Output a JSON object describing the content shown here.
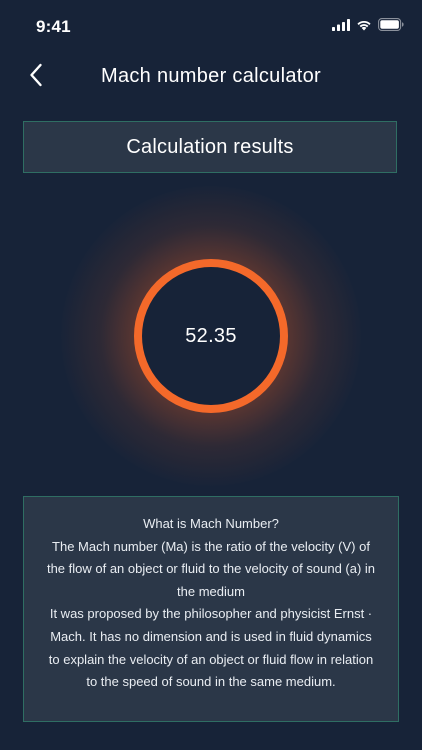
{
  "status": {
    "time": "9:41",
    "icons": [
      "cellular-signal-icon",
      "wifi-icon",
      "battery-icon"
    ]
  },
  "nav": {
    "title": "Mach number calculator",
    "back_icon": "chevron-left-icon"
  },
  "results": {
    "header": "Calculation results",
    "value": "52.35"
  },
  "info": {
    "title": "What is Mach Number?",
    "paragraph1": "The Mach number (Ma) is the ratio of the velocity (V) of the flow of an object or fluid to the velocity of sound (a) in the medium",
    "paragraph2": "It was proposed by the philosopher and physicist Ernst · Mach. It has no dimension and is used in fluid dynamics to explain the velocity of an object or fluid flow in relation to the speed of sound in the same medium."
  },
  "colors": {
    "background": "#172338",
    "panel": "#2b3748",
    "panel_border": "#2f6e63",
    "ring": "#f4692a",
    "text": "#ffffff"
  }
}
